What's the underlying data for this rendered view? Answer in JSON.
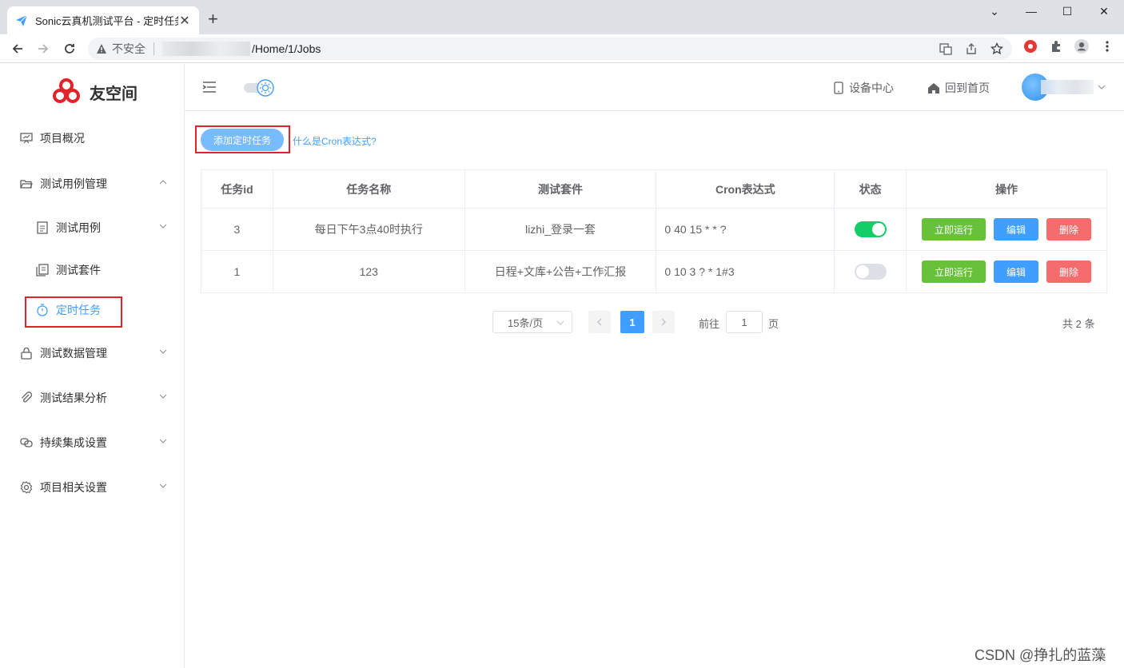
{
  "browser": {
    "tab_title": "Sonic云真机测试平台 - 定时任务",
    "security_label": "不安全",
    "url_path": "/Home/1/Jobs"
  },
  "sidebar": {
    "logo_text": "友空间",
    "items": [
      {
        "label": "项目概况"
      },
      {
        "label": "测试用例管理"
      },
      {
        "label": "测试用例"
      },
      {
        "label": "测试套件"
      },
      {
        "label": "定时任务"
      },
      {
        "label": "测试数据管理"
      },
      {
        "label": "测试结果分析"
      },
      {
        "label": "持续集成设置"
      },
      {
        "label": "项目相关设置"
      }
    ],
    "active_color": "#409eff"
  },
  "header": {
    "device_center": "设备中心",
    "back_home": "回到首页"
  },
  "toolbar": {
    "add_label": "添加定时任务",
    "cron_help": "什么是Cron表达式?"
  },
  "table": {
    "columns": [
      "任务id",
      "任务名称",
      "测试套件",
      "Cron表达式",
      "状态",
      "操作"
    ],
    "rows": [
      {
        "id": "3",
        "name": "每日下午3点40时执行",
        "suite": "lizhi_登录一套",
        "cron": "0 40 15 * * ?",
        "enabled": true
      },
      {
        "id": "1",
        "name": "123",
        "suite": "日程+文库+公告+工作汇报",
        "cron": "0 10 3 ? * 1#3",
        "enabled": false
      }
    ],
    "actions": {
      "run": "立即运行",
      "edit": "编辑",
      "delete": "删除"
    }
  },
  "pagination": {
    "page_size": "15条/页",
    "current_page": "1",
    "goto_label": "前往",
    "goto_value": "1",
    "page_unit": "页",
    "total": "共 2 条"
  },
  "watermark": "CSDN @挣扎的蓝藻",
  "colors": {
    "success": "#67c23a",
    "primary": "#409eff",
    "danger": "#f56c6c",
    "switch_on": "#13ce66"
  }
}
